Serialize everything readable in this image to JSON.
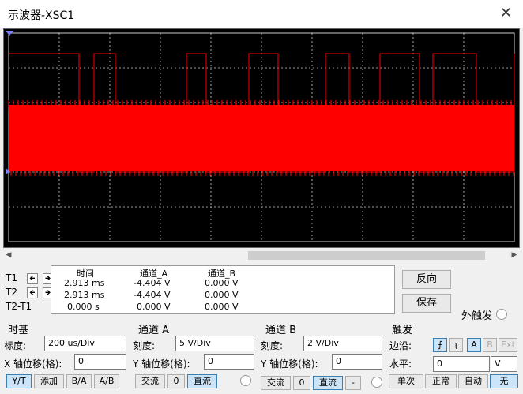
{
  "window": {
    "title": "示波器-XSC1",
    "close_glyph": "✕"
  },
  "screen": {
    "background": "#000000",
    "trace_color": "#ff0000",
    "grid_color": "#cccccc"
  },
  "cursors": {
    "t1": "T1",
    "t2": "T2",
    "diff": "T2-T1",
    "left_arrow": "🡸",
    "right_arrow": "🡺"
  },
  "readout": {
    "headers": [
      "时间",
      "通道_A",
      "通道_B"
    ],
    "rows": [
      [
        "2.913 ms",
        "-4.404 V",
        "0.000 V"
      ],
      [
        "2.913 ms",
        "-4.404 V",
        "0.000 V"
      ],
      [
        "0.000 s",
        "0.000 V",
        "0.000 V"
      ]
    ]
  },
  "buttons": {
    "reverse": "反向",
    "save": "保存",
    "ext_trigger": "外触发"
  },
  "timebase": {
    "label": "时基",
    "scale_label": "标度:",
    "scale_value": "200 us/Div",
    "xpos_label": "X 轴位移(格):",
    "xpos_value": "0",
    "modes": [
      "Y/T",
      "添加",
      "B/A",
      "A/B"
    ]
  },
  "channel_a": {
    "label": "通道 A",
    "scale_label": "刻度:",
    "scale_value": "5  V/Div",
    "ypos_label": "Y 轴位移(格):",
    "ypos_value": "0",
    "coupling": [
      "交流",
      "0",
      "直流"
    ]
  },
  "channel_b": {
    "label": "通道 B",
    "scale_label": "刻度:",
    "scale_value": "2  V/Div",
    "ypos_label": "Y 轴位移(格):",
    "ypos_value": "0",
    "coupling": [
      "交流",
      "0",
      "直流",
      "-"
    ]
  },
  "trigger": {
    "label": "触发",
    "edge_label": "边沿:",
    "edges": [
      "⨍",
      "ʅ",
      "A",
      "B",
      "Ext"
    ],
    "level_label": "水平:",
    "level_value": "0",
    "level_unit": "V",
    "modes": [
      "单次",
      "正常",
      "自动",
      "无"
    ]
  }
}
